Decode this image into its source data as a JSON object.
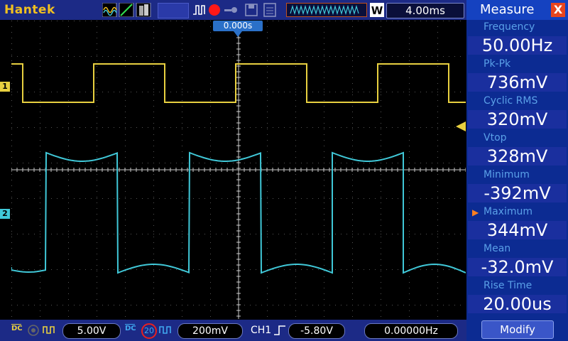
{
  "brand": "Hantek",
  "timebase": "4.00ms",
  "trigger_position": "0.000s",
  "channels": {
    "ch1_marker": "1",
    "ch2_marker": "2",
    "ch1_color": "#e8d040",
    "ch2_color": "#40c8d8"
  },
  "measure": {
    "title": "Measure",
    "close": "X",
    "items": [
      {
        "label": "Frequency",
        "value": "50.00Hz"
      },
      {
        "label": "Pk-Pk",
        "value": "736mV"
      },
      {
        "label": "Cyclic RMS",
        "value": "320mV"
      },
      {
        "label": "Vtop",
        "value": "328mV"
      },
      {
        "label": "Minimum",
        "value": "-392mV"
      },
      {
        "label": "Maximum",
        "value": "344mV"
      },
      {
        "label": "Mean",
        "value": "-32.0mV"
      },
      {
        "label": "Rise Time",
        "value": "20.00us"
      }
    ],
    "modify": "Modify"
  },
  "bottom": {
    "ch1_coupling": "DC",
    "ch1_scale": "5.00V",
    "ch2_coupling": "DC",
    "ch2_bw": "20",
    "ch2_scale": "200mV",
    "trigger_source": "CH1",
    "trigger_level": "-5.80V",
    "frequency": "0.00000Hz"
  }
}
